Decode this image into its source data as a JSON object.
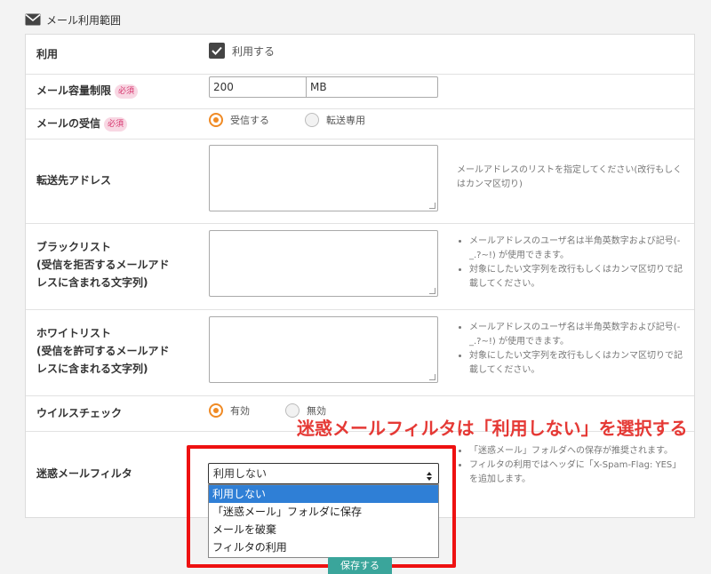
{
  "section": {
    "title": "メール利用範囲",
    "icon": "envelope-icon"
  },
  "rows": {
    "usage": {
      "label": "利用",
      "checkbox_label": "利用する",
      "checked": true
    },
    "capacity": {
      "label": "メール容量制限",
      "badge": "必須",
      "value": "200",
      "unit": "MB"
    },
    "receive": {
      "label": "メールの受信",
      "badge": "必須",
      "option1": "受信する",
      "option2": "転送専用",
      "selected": "受信する"
    },
    "forward": {
      "label": "転送先アドレス",
      "help": "メールアドレスのリストを指定してください(改行もしくはカンマ区切り)"
    },
    "blacklist": {
      "label1": "ブラックリスト",
      "label2": "(受信を拒否するメールアド",
      "label3": "レスに含まれる文字列)",
      "help1": "メールアドレスのユーザ名は半角英数字および記号(-_.?~!) が使用できます。",
      "help2": "対象にしたい文字列を改行もしくはカンマ区切りで記載してください。"
    },
    "whitelist": {
      "label1": "ホワイトリスト",
      "label2": "(受信を許可するメールアド",
      "label3": "レスに含まれる文字列)",
      "help1": "メールアドレスのユーザ名は半角英数字および記号(-_.?~!) が使用できます。",
      "help2": "対象にしたい文字列を改行もしくはカンマ区切りで記載してください。"
    },
    "virus": {
      "label": "ウイルスチェック",
      "option1": "有効",
      "option2": "無効",
      "selected": "有効"
    },
    "spam": {
      "label": "迷惑メールフィルタ",
      "selected": "利用しない",
      "options": [
        "利用しない",
        "「迷惑メール」フォルダに保存",
        "メールを破棄",
        "フィルタの利用"
      ],
      "help1": "「迷惑メール」フォルダへの保存が推奨されます。",
      "help2": "フィルタの利用ではヘッダに「X-Spam-Flag: YES」を追加します。"
    }
  },
  "annotation": {
    "text": "迷惑メールフィルタは「利用しない」を選択する",
    "color": "#e53935"
  },
  "save_button": {
    "label": "保存する"
  },
  "colors": {
    "accent_radio": "#f08a24",
    "dropdown_highlight": "#2f7fd6",
    "badge_bg": "#f8d7e3",
    "badge_text": "#d6336c",
    "button": "#3aa59b"
  }
}
